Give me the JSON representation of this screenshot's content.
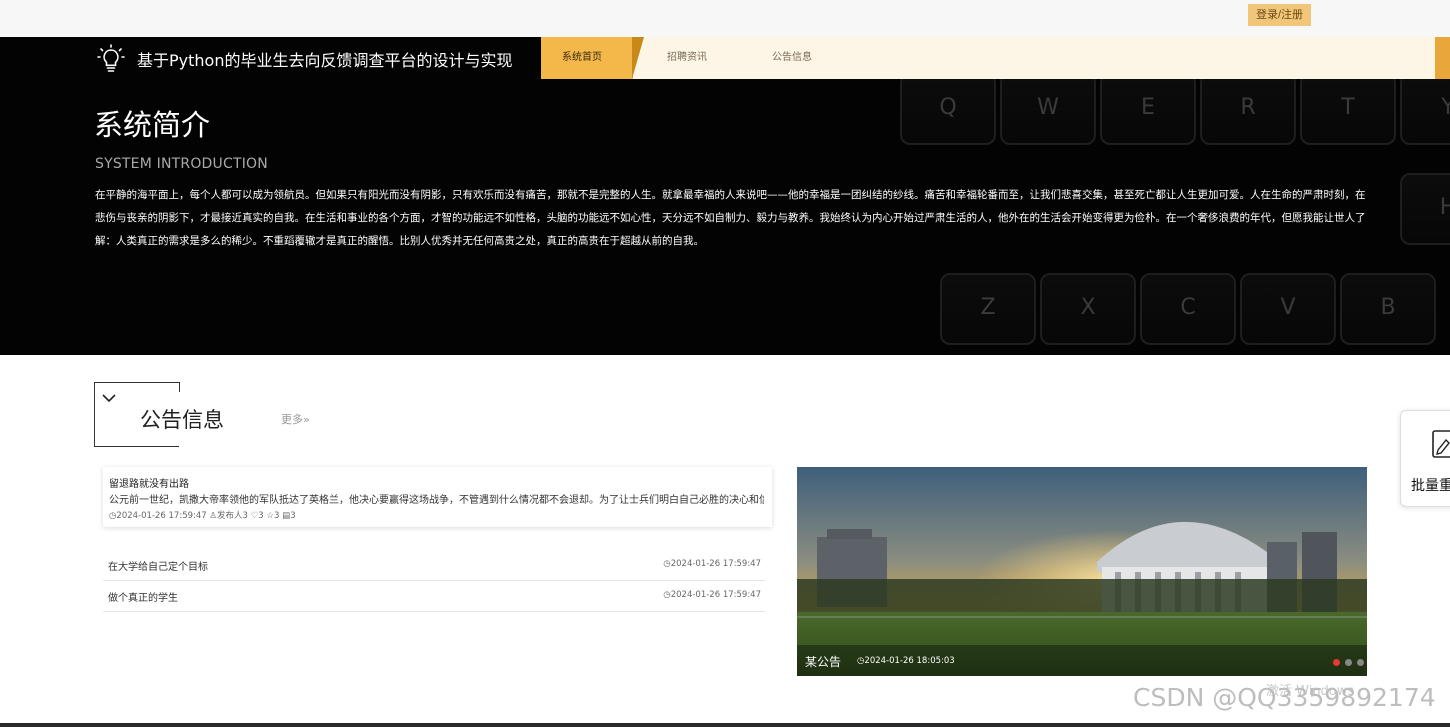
{
  "topbar": {
    "login_label": "登录/注册"
  },
  "header": {
    "site_title": "基于Python的毕业生去向反馈调查平台的设计与实现",
    "nav": [
      {
        "label": "系统首页",
        "active": true
      },
      {
        "label": "招聘资讯",
        "active": false
      },
      {
        "label": "公告信息",
        "active": false
      }
    ],
    "accent_color": "#f3b74a"
  },
  "intro": {
    "title": "系统简介",
    "subtitle": "SYSTEM INTRODUCTION",
    "body": "在平静的海平面上，每个人都可以成为领航员。但如果只有阳光而没有阴影，只有欢乐而没有痛苦，那就不是完整的人生。就拿最幸福的人来说吧——他的幸福是一团纠结的纱线。痛苦和幸福轮番而至，让我们悲喜交集，甚至死亡都让人生更加可爱。人在生命的严肃时刻，在悲伤与丧亲的阴影下，才最接近真实的自我。在生活和事业的各个方面，才智的功能远不如性格，头脑的功能远不如心性，天分远不如自制力、毅力与教养。我始终认为内心开始过严肃生活的人，他外在的生活会开始变得更为俭朴。在一个奢侈浪费的年代，但愿我能让世人了解：人类真正的需求是多么的稀少。不重蹈覆辙才是真正的醒悟。比别人优秀并无任何高贵之处，真正的高贵在于超越从前的自我。",
    "keyboard_keys": [
      "Q",
      "W",
      "E",
      "R",
      "T",
      "Y",
      "H",
      "Z",
      "X",
      "C",
      "V",
      "B"
    ]
  },
  "notices": {
    "section_title": "公告信息",
    "more_label": "更多»",
    "featured": {
      "title": "留退路就没有出路",
      "excerpt": "公元前一世纪，凯撒大帝率领他的军队抵达了英格兰，他决心要赢得这场战争，不管遇到什么情况都不会退却。为了让士兵们明白自己必胜的决心和信",
      "time": "2024-01-26 17:59:47",
      "publisher": "发布人3",
      "likes": "3",
      "favorites": "3",
      "comments": "3"
    },
    "list": [
      {
        "title": "在大学给自己定个目标",
        "time": "2024-01-26 17:59:47"
      },
      {
        "title": "做个真正的学生",
        "time": "2024-01-26 17:59:47"
      }
    ],
    "banner": {
      "caption": "某公告",
      "time": "2024-01-26 18:05:03",
      "active_dot": 0,
      "dot_count": 3
    }
  },
  "side_widget": {
    "label": "批量重",
    "icon": "edit-icon"
  },
  "watermarks": {
    "windows": "激活 Windows",
    "csdn": "CSDN @QQ3359892174"
  }
}
